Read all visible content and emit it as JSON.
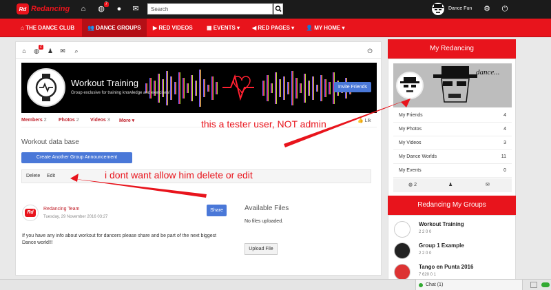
{
  "brand": {
    "badge": "Rd",
    "name": "Redancing"
  },
  "topbar": {
    "notification_count": "7",
    "search_placeholder": "Search",
    "user_name": "Dance Fun"
  },
  "nav": {
    "items": [
      {
        "label": "THE DANCE CLUB"
      },
      {
        "label": "DANCE GROUPS"
      },
      {
        "label": "RED VIDEOS"
      },
      {
        "label": "EVENTS ▾"
      },
      {
        "label": "RED PAGES ▾"
      },
      {
        "label": "MY HOME ▾"
      }
    ]
  },
  "group": {
    "subbar_badge": "2",
    "title": "Workout Training",
    "description": "Group exclusive for training knowledge and exercises!",
    "invite_label": "Invite Friends",
    "tabs": [
      {
        "label": "Members",
        "count": "2"
      },
      {
        "label": "Photos",
        "count": "2"
      },
      {
        "label": "Videos",
        "count": "3"
      },
      {
        "label": "More ▾",
        "count": ""
      }
    ],
    "like_label": "Lik",
    "section_title": "Workout data base",
    "create_label": "Create Another Group Announcement",
    "actions": {
      "delete": "Delete",
      "edit": "Edit"
    }
  },
  "post": {
    "avatar_text": "Rd",
    "author": "Redancing Team",
    "date": "Tuesday, 29 November 2016 03:27",
    "share_label": "Share",
    "body": "If you have any info about workout for dancers please share and be part of the next biggest Dance world!!!"
  },
  "files": {
    "title": "Available Files",
    "empty": "No files uploaded.",
    "upload_label": "Upload File"
  },
  "sidebar": {
    "panel_title": "My Redancing",
    "cover_text": "dance...",
    "stats": [
      {
        "label": "My Friends",
        "value": "4"
      },
      {
        "label": "My Photos",
        "value": "4"
      },
      {
        "label": "My Videos",
        "value": "3"
      },
      {
        "label": "My Dance Worlds",
        "value": "11"
      },
      {
        "label": "My Events",
        "value": "0"
      }
    ],
    "stat_bar_count": "2",
    "groups_title": "Redancing My Groups",
    "groups": [
      {
        "name": "Workout Training",
        "meta": "2   2   0   0"
      },
      {
        "name": "Group 1 Example",
        "meta": "2   2   0   0"
      },
      {
        "name": "Tango en Punta 2016",
        "meta": "7   620   0   1"
      }
    ]
  },
  "chat": {
    "label": "Chat (1)"
  },
  "annotations": {
    "tester": "this a tester user, NOT admin",
    "no_delete": "i dont want allow him delete or edit"
  },
  "colors": {
    "brand_red": "#e8141c",
    "button_blue": "#4a78d8",
    "dark_bar": "#1b1b1b"
  }
}
